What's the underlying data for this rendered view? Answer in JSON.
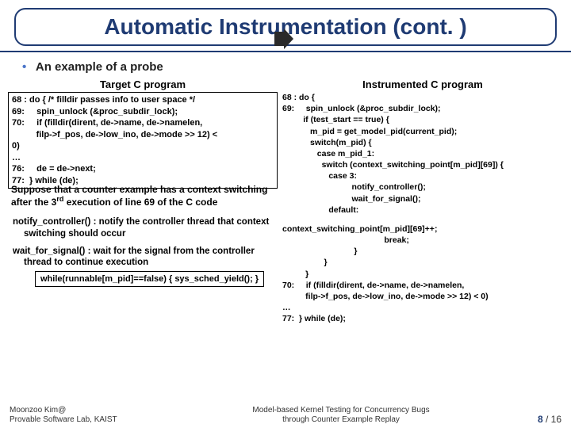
{
  "title": "Automatic Instrumentation (cont. )",
  "bullet": "An example of a probe",
  "left": {
    "heading": "Target C program",
    "code": "68 : do { /* filldir passes info to user space */\n69:     spin_unlock (&proc_subdir_lock);\n70:     if (filldir(dirent, de->name, de->namelen,\n          filp->f_pos, de->low_ino, de->mode >> 12) <\n0)\n…\n76:     de = de->next;\n77:  } while (de);",
    "caption_pre": "Suppose that a counter example has a context switching after the 3",
    "caption_sup": "rd",
    "caption_post": " execution of line 69 of the C code",
    "notify_head": "notify_controller() :",
    "notify_body": " notify the controller thread that context switching should occur",
    "wait_head": "wait_for_signal() :",
    "wait_body": " wait for the signal from the controller thread to continue execution",
    "snippet": "while(runnable[m_pid]==false) {\n    sys_sched_yield();\n}"
  },
  "right": {
    "heading": "Instrumented C program",
    "code": "68 : do {\n69:     spin_unlock (&proc_subdir_lock);\n         if (test_start == true) {\n            m_pid = get_model_pid(current_pid);\n            switch(m_pid) {\n               case m_pid_1:\n                 switch (context_switching_point[m_pid][69]) {\n                    case 3:\n                              notify_controller();\n                              wait_for_signal();\n                    default:",
    "code2": "context_switching_point[m_pid][69]++;\n                                            break;\n                               }\n                  }\n          }\n70:     if (filldir(dirent, de->name, de->namelen,\n          filp->f_pos, de->low_ino, de->mode >> 12) < 0)\n…\n77:  } while (de);"
  },
  "footer": {
    "left1": "Moonzoo Kim@",
    "left2": "Provable Software Lab, KAIST",
    "center1": "Model-based Kernel Testing for Concurrency Bugs",
    "center2": "through Counter Example Replay",
    "page_current": "8",
    "page_sep": " / ",
    "page_total": "16"
  }
}
